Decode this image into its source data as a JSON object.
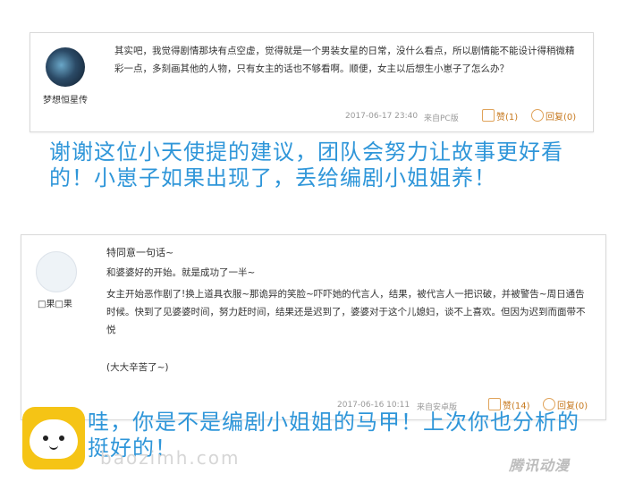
{
  "comments": [
    {
      "username": "梦想恒星传",
      "text": "其实吧，我觉得剧情那块有点空虚，觉得就是一个男装女星的日常，没什么看点，所以剧情能不能设计得稍微精彩一点，多刻画其他的人物，只有女主的话也不够看啊。顺便，女主以后想生小崽子了怎么办？",
      "date": "2017-06-17 23:40",
      "source": "来自PC版",
      "like_label": "赞(1)",
      "reply_label": "回复(0)"
    },
    {
      "username": "□果□果",
      "title": "特同意一句话~",
      "line1": "和婆婆好的开始。就是成功了一半~",
      "line2": "女主开始恶作剧了!换上道具衣服~那诡异的笑脸~吓吓她的代言人，结果，被代言人一把识破，并被警告~周日通告时候。快到了见婆婆时间，努力赶时间，结果还是迟到了，婆婆对于这个儿媳妇，谈不上喜欢。但因为迟到而面带不悦",
      "line3": "(大大辛苦了~)",
      "date": "2017-06-16 10:11",
      "source": "来自安卓版",
      "like_label": "赞(14)",
      "reply_label": "回复(0)"
    }
  ],
  "callouts": {
    "first": "谢谢这位小天使提的建议，团队会努力让故事更好看的！小崽子如果出现了，丢给编剧小姐姐养！",
    "second": "哇，你是不是编剧小姐姐的马甲！上次你也分析的挺好的！"
  },
  "watermark": {
    "site": "baozimh.com",
    "corner": "腾讯动漫"
  },
  "colors": {
    "callout": "#2f96d9",
    "accent": "#c77a20",
    "logo_yellow": "#f5c415"
  },
  "icons": [
    "like-icon",
    "reply-icon",
    "bun-logo"
  ]
}
